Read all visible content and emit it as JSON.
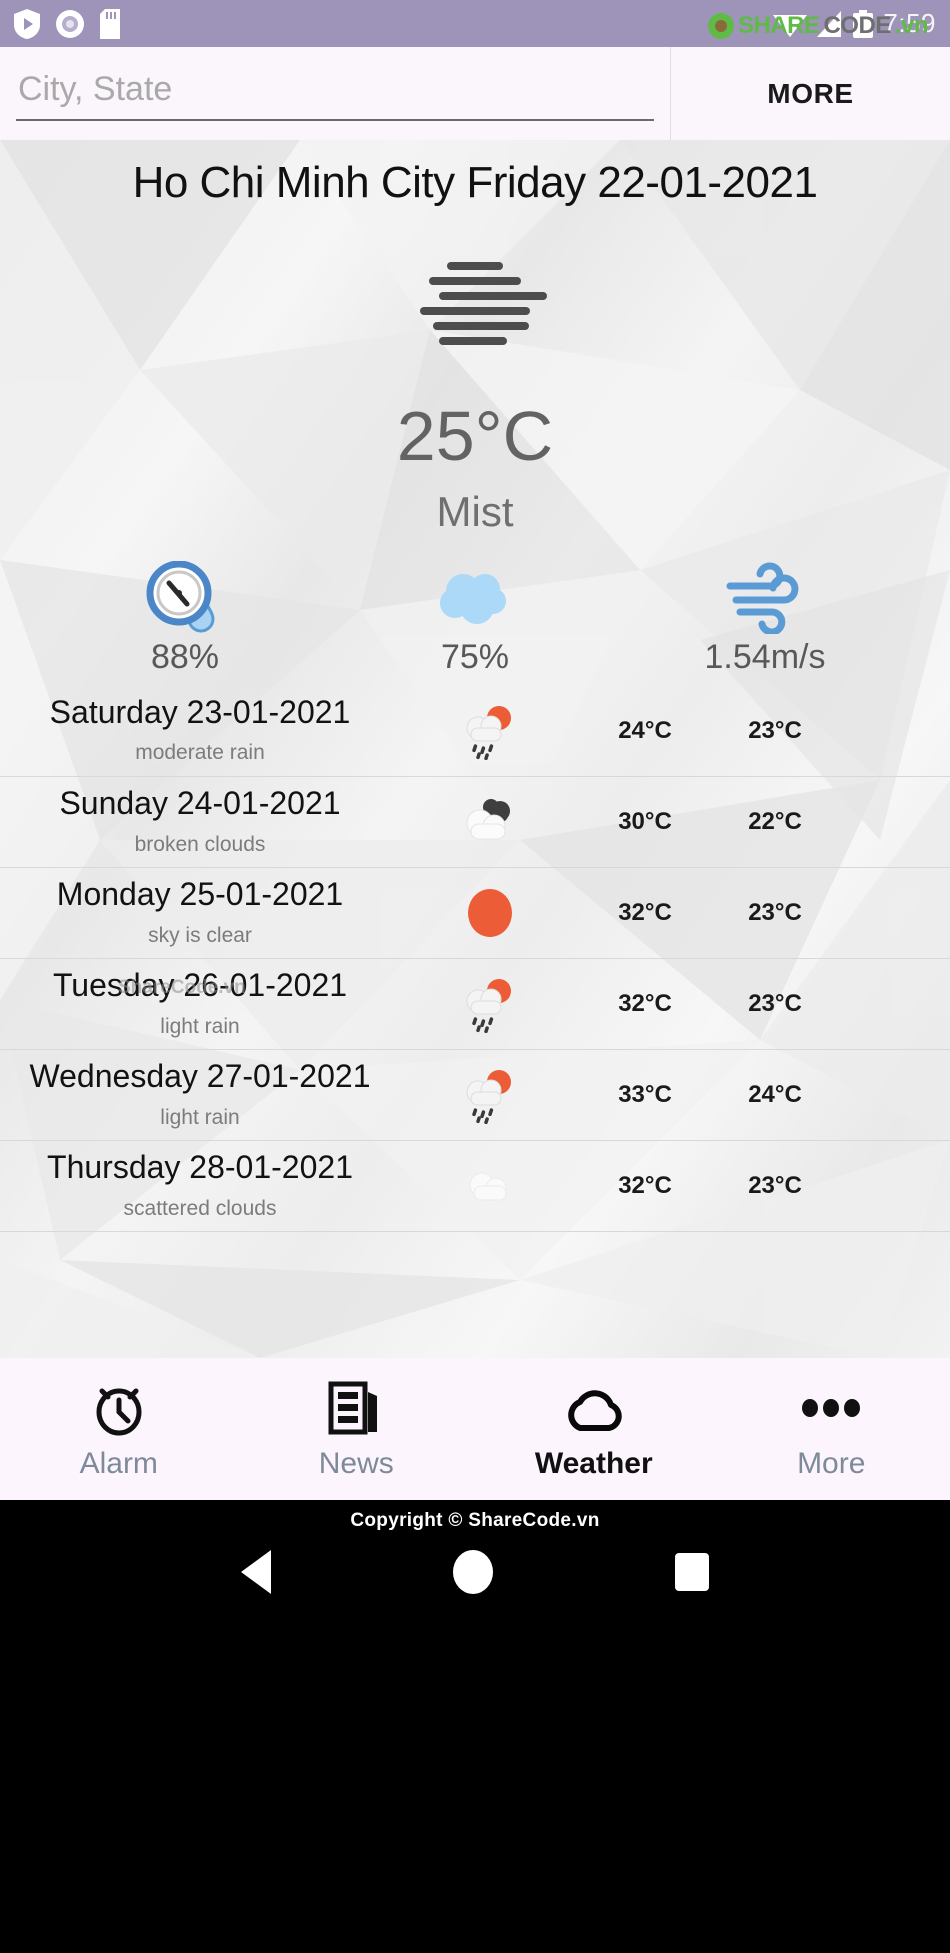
{
  "statusbar": {
    "time": "7:59",
    "icons": [
      "play-shield-icon",
      "record-icon",
      "sdcard-icon",
      "wifi-icon",
      "signal-icon",
      "battery-icon"
    ],
    "watermark": {
      "share": "SHARE",
      "code": "CODE",
      "vn": ".vn"
    }
  },
  "search": {
    "placeholder": "City, State",
    "value": "",
    "more_label": "MORE"
  },
  "current": {
    "headline": "Ho Chi Minh City  Friday 22-01-2021",
    "city": "Ho Chi Minh City",
    "date": "Friday 22-01-2021",
    "temperature": "25°C",
    "condition": "Mist",
    "icon": "mist-icon",
    "stats": [
      {
        "name": "humidity",
        "icon": "humidity-gauge-icon",
        "value": "88%"
      },
      {
        "name": "clouds",
        "icon": "cloud-icon",
        "value": "75%"
      },
      {
        "name": "wind",
        "icon": "wind-icon",
        "value": "1.54m/s"
      }
    ]
  },
  "forecast": [
    {
      "day": "Saturday 23-01-2021",
      "desc": "moderate rain",
      "icon": "sun-rain-cloud-icon",
      "high": "24°C",
      "low": "23°C"
    },
    {
      "day": "Sunday 24-01-2021",
      "desc": "broken clouds",
      "icon": "broken-clouds-icon",
      "high": "30°C",
      "low": "22°C"
    },
    {
      "day": "Monday 25-01-2021",
      "desc": "sky is clear",
      "icon": "sun-icon",
      "high": "32°C",
      "low": "23°C"
    },
    {
      "day": "Tuesday 26-01-2021",
      "desc": "light rain",
      "icon": "sun-rain-cloud-icon",
      "high": "32°C",
      "low": "23°C"
    },
    {
      "day": "Wednesday 27-01-2021",
      "desc": "light rain",
      "icon": "sun-rain-cloud-icon",
      "high": "33°C",
      "low": "24°C"
    },
    {
      "day": "Thursday 28-01-2021",
      "desc": "scattered clouds",
      "icon": "scattered-clouds-icon",
      "high": "32°C",
      "low": "23°C"
    }
  ],
  "watermarks": {
    "row_tuesday": "ShareCode.vn",
    "row_tuesday2": "ShareCode.vn"
  },
  "tabs": [
    {
      "label": "Alarm",
      "icon": "alarm-clock-icon",
      "active": false
    },
    {
      "label": "News",
      "icon": "newspaper-icon",
      "active": false
    },
    {
      "label": "Weather",
      "icon": "cloud-icon",
      "active": true
    },
    {
      "label": "More",
      "icon": "ellipsis-icon",
      "active": false
    }
  ],
  "footer": {
    "copyright": "Copyright © ShareCode.vn",
    "nav": [
      "back-button",
      "home-button",
      "recents-button"
    ]
  },
  "colors": {
    "statusbar": "#9e93b8",
    "chrome": "#fbf5fc",
    "accent_blue": "#5b9bd5",
    "cloud_blue": "#abd9f7",
    "sun_orange": "#ec5c37",
    "active_tab": "#101010",
    "inactive_tab": "#7e8a99"
  }
}
